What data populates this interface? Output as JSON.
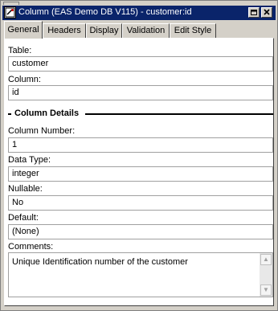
{
  "window": {
    "title": "Column (EAS Demo DB V115) - customer:id",
    "icons": {
      "app": "column-icon",
      "restore": "restore-icon",
      "close": "close-icon"
    }
  },
  "tabs": [
    {
      "label": "General",
      "active": true
    },
    {
      "label": "Headers",
      "active": false
    },
    {
      "label": "Display",
      "active": false
    },
    {
      "label": "Validation",
      "active": false
    },
    {
      "label": "Edit Style",
      "active": false
    }
  ],
  "general": {
    "table_label": "Table:",
    "table_value": "customer",
    "column_label": "Column:",
    "column_value": "id",
    "section_title": "Column Details",
    "column_number_label": "Column Number:",
    "column_number_value": "1",
    "data_type_label": "Data Type:",
    "data_type_value": "integer",
    "nullable_label": "Nullable:",
    "nullable_value": "No",
    "default_label": "Default:",
    "default_value": "(None)",
    "comments_label": "Comments:",
    "comments_value": "Unique Identification number of the customer"
  }
}
